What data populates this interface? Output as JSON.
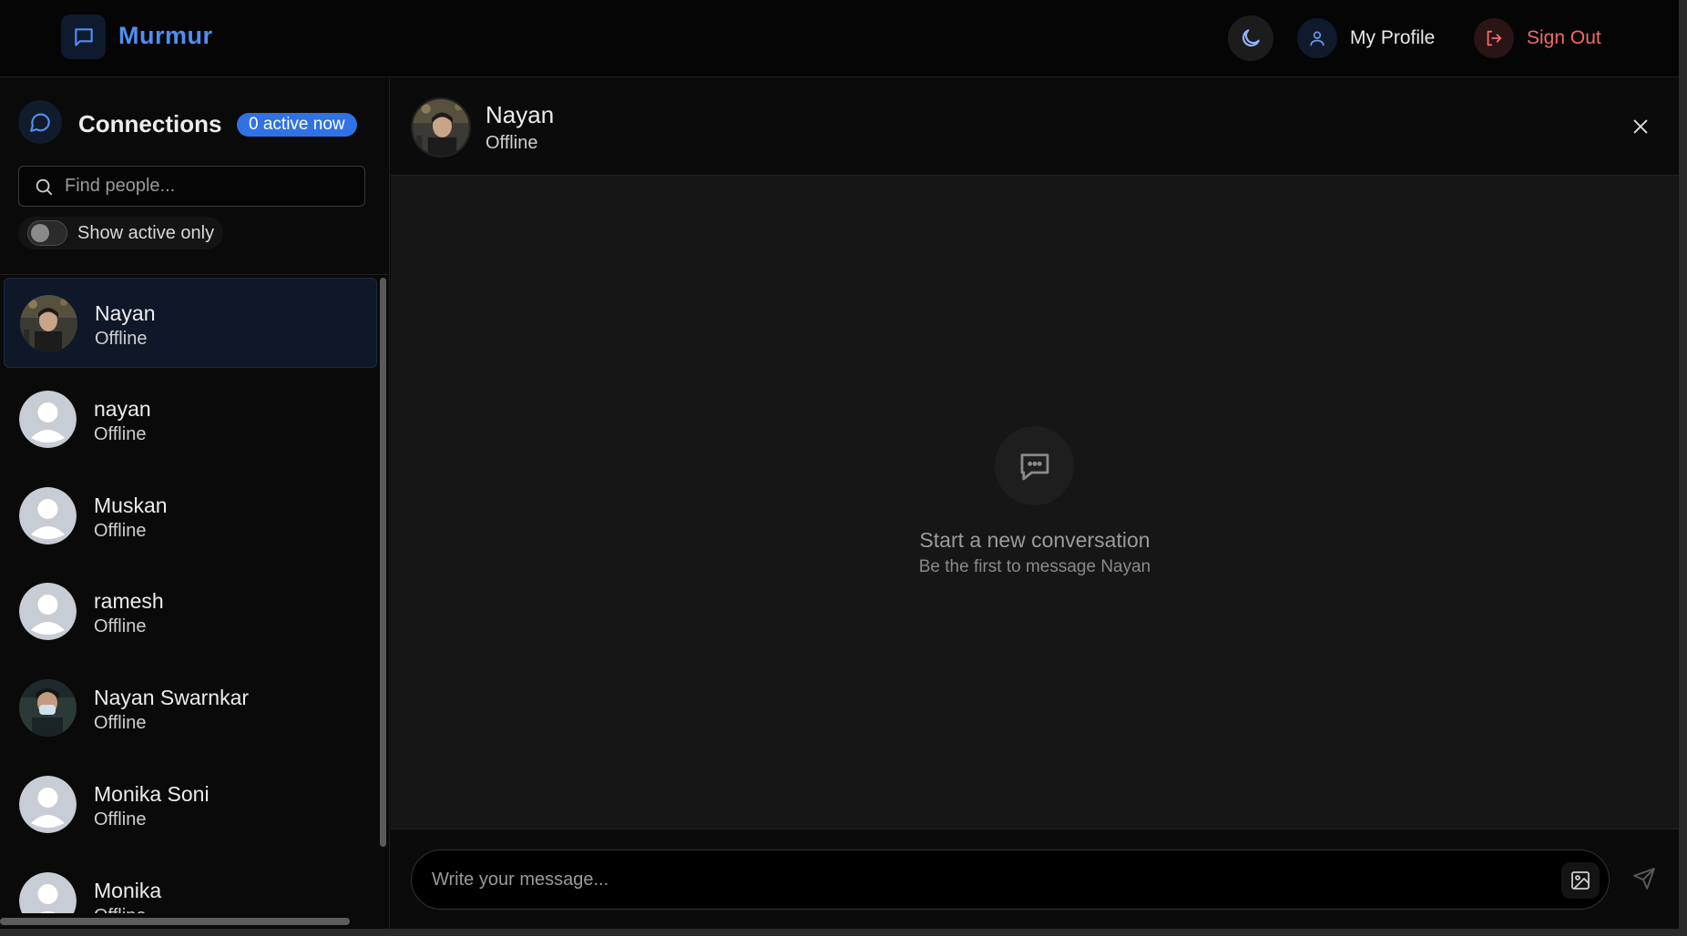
{
  "header": {
    "app_name": "Murmur",
    "theme_icon": "moon-icon",
    "profile_label": "My Profile",
    "signout_label": "Sign Out"
  },
  "sidebar": {
    "title": "Connections",
    "active_badge": "0 active now",
    "search_placeholder": "Find people...",
    "toggle_label": "Show active only",
    "toggle_on": false,
    "contacts": [
      {
        "name": "Nayan",
        "status": "Offline",
        "avatar": "photo",
        "selected": true
      },
      {
        "name": "nayan",
        "status": "Offline",
        "avatar": "default"
      },
      {
        "name": "Muskan",
        "status": "Offline",
        "avatar": "default"
      },
      {
        "name": "ramesh",
        "status": "Offline",
        "avatar": "default"
      },
      {
        "name": "Nayan Swarnkar",
        "status": "Offline",
        "avatar": "photo"
      },
      {
        "name": "Monika Soni",
        "status": "Offline",
        "avatar": "default"
      },
      {
        "name": "Monika",
        "status": "Offline",
        "avatar": "default"
      }
    ]
  },
  "chat": {
    "name": "Nayan",
    "status": "Offline",
    "empty_title": "Start a new conversation",
    "empty_subtitle": "Be the first to message Nayan",
    "message_placeholder": "Write your message..."
  },
  "colors": {
    "accent": "#4f8ff0",
    "badge": "#2f72e6",
    "signout": "#f26a6a",
    "background": "#0b0b0b"
  }
}
